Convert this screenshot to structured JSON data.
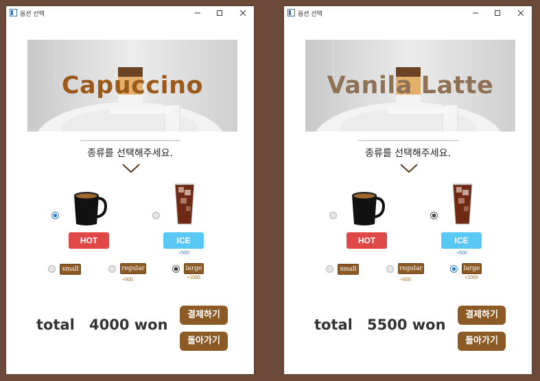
{
  "windows": [
    {
      "title": "옵션 선택",
      "banner_title": "Capuccino",
      "banner_title_color": "#9c5a1a",
      "prompt": "종류를 선택해주세요.",
      "temp_options": [
        {
          "label": "HOT",
          "surcharge": "",
          "selected": true
        },
        {
          "label": "ICE",
          "surcharge": "+500",
          "selected": false
        }
      ],
      "size_options": [
        {
          "label": "small",
          "surcharge": "",
          "selected": false
        },
        {
          "label": "regular",
          "surcharge": "+500",
          "selected": false
        },
        {
          "label": "large",
          "surcharge": "+1000",
          "selected": true
        }
      ],
      "total_label": "total",
      "total_amount": "4000 won",
      "pay_button": "결제하기",
      "back_button": "돌아가기"
    },
    {
      "title": "옵션 선택",
      "banner_title": "Vanila Latte",
      "banner_title_color": "#8f7256",
      "prompt": "종류를 선택해주세요.",
      "temp_options": [
        {
          "label": "HOT",
          "surcharge": "",
          "selected": false
        },
        {
          "label": "ICE",
          "surcharge": "+500",
          "selected": true
        }
      ],
      "size_options": [
        {
          "label": "small",
          "surcharge": "",
          "selected": false
        },
        {
          "label": "regular",
          "surcharge": "+500",
          "selected": false
        },
        {
          "label": "large",
          "surcharge": "+1000",
          "selected": true
        }
      ],
      "total_label": "total",
      "total_amount": "5500 won",
      "pay_button": "결제하기",
      "back_button": "돌아가기"
    }
  ],
  "icons": {
    "app": "app-icon",
    "minimize": "minimize-icon",
    "maximize": "maximize-icon",
    "close": "close-icon",
    "chevron": "chevron-down-icon",
    "hot_coffee": "hot-coffee-mug-icon",
    "iced_coffee": "iced-coffee-glass-icon"
  },
  "colors": {
    "brown_button": "#8b5a25",
    "hot_button": "#e04848",
    "ice_button": "#5ac8f5",
    "radio_selected": "#2f7fd0"
  }
}
